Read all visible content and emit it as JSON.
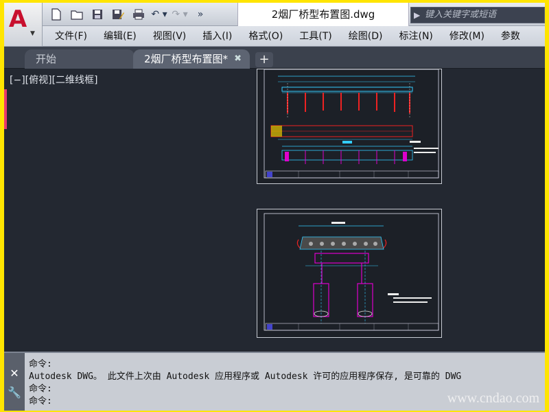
{
  "app": {
    "title": "2烟厂桥型布置图.dwg",
    "search_placeholder": "键入关键字或短语"
  },
  "qa_toolbar": {
    "icons": [
      "new-icon",
      "open-icon",
      "save-icon",
      "save-as-icon",
      "print-icon",
      "undo-icon",
      "redo-icon",
      "more-icon"
    ]
  },
  "menu": {
    "items": [
      "文件(F)",
      "编辑(E)",
      "视图(V)",
      "插入(I)",
      "格式(O)",
      "工具(T)",
      "绘图(D)",
      "标注(N)",
      "修改(M)",
      "参数"
    ]
  },
  "tabs": {
    "start": "开始",
    "active": "2烟厂桥型布置图*"
  },
  "viewport": {
    "label": "[−][俯视][二维线框]"
  },
  "command": {
    "lines": [
      "命令:",
      "Autodesk DWG。  此文件上次由 Autodesk 应用程序或 Autodesk 许可的应用程序保存, 是可靠的 DWG",
      "命令:",
      "命令:"
    ]
  },
  "watermark": "www.cndao.com",
  "colors": {
    "frame": "#ffe500",
    "canvas": "#232831",
    "accent_red": "#c8102e"
  }
}
